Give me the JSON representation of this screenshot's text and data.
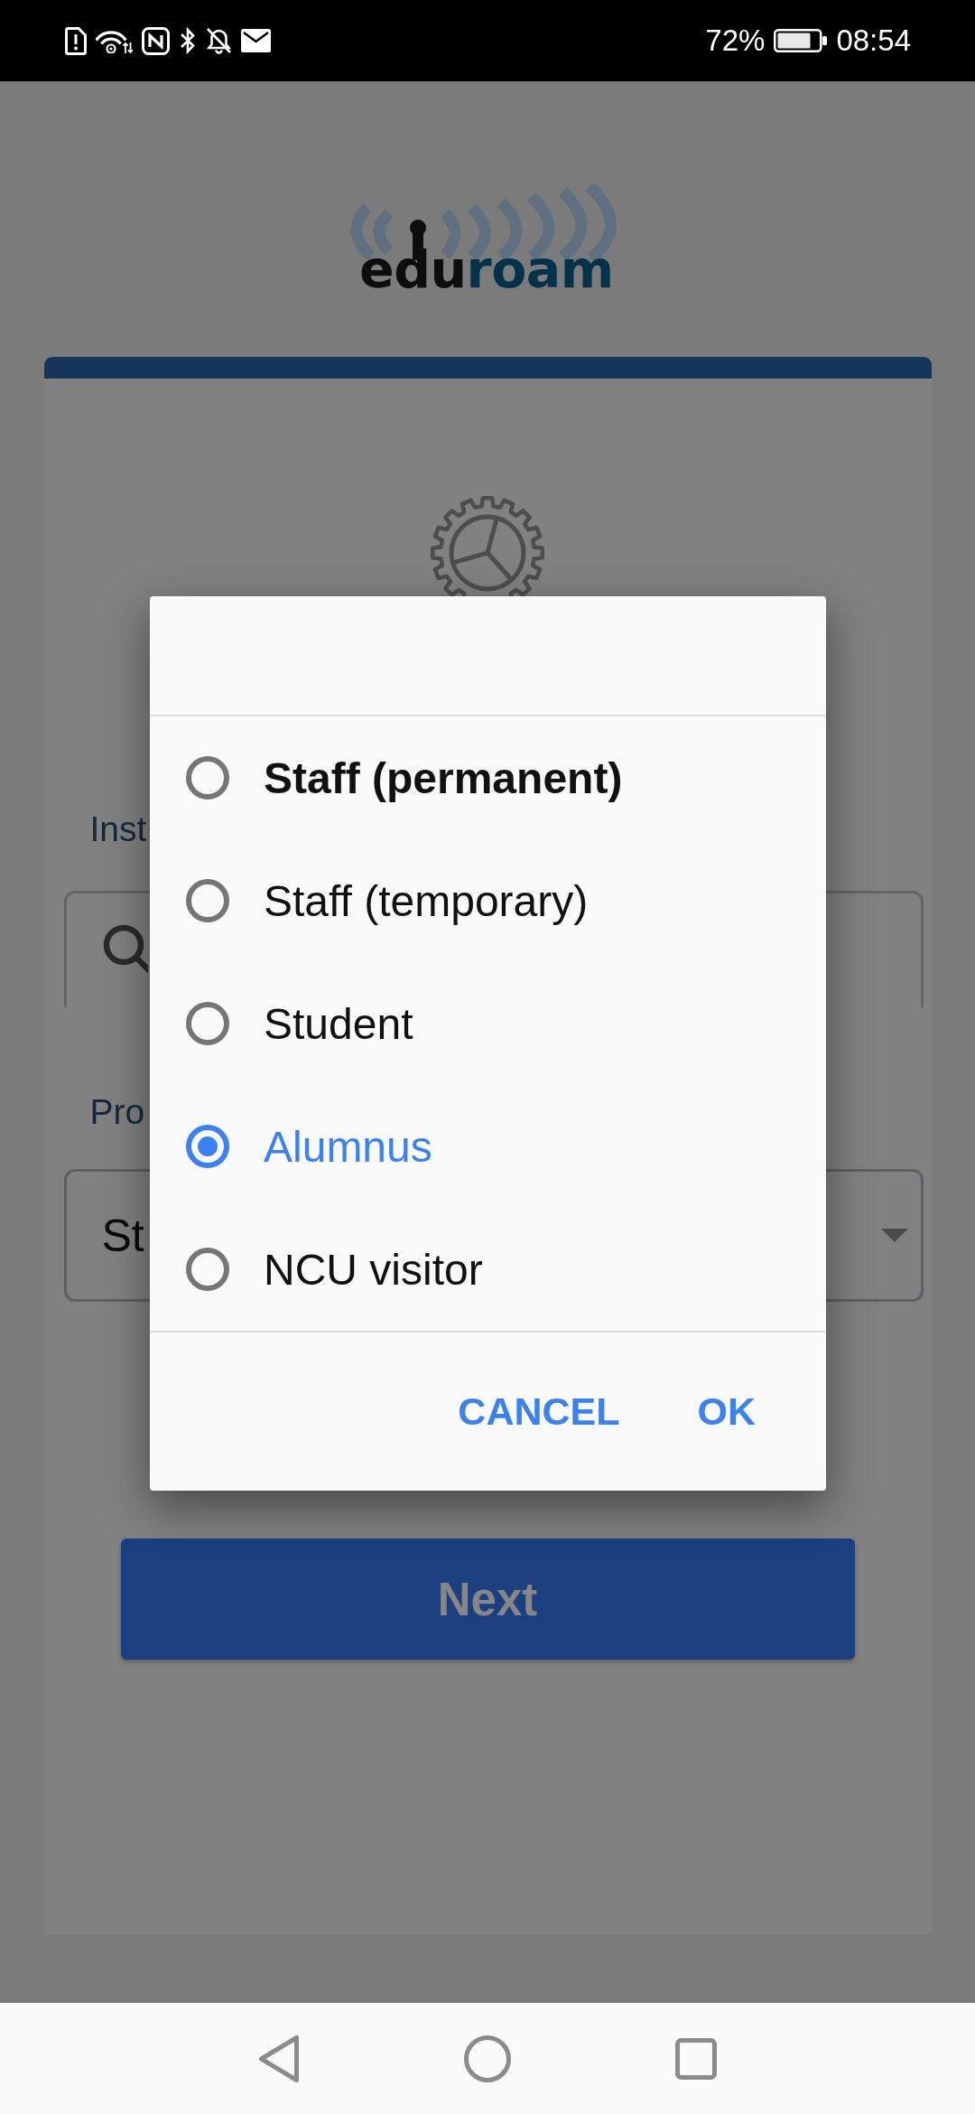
{
  "status_bar": {
    "battery": "72%",
    "time": "08:54"
  },
  "logo": {
    "parts": [
      {
        "text": "edu",
        "color": "#0d0d0d"
      },
      {
        "text": "roam",
        "color": "#00334a"
      }
    ]
  },
  "form": {
    "institution": {
      "label": "Inst"
    },
    "profile": {
      "label": "Pro",
      "value": "St"
    },
    "next_button": "Next"
  },
  "dialog": {
    "options": [
      {
        "label": "Staff (permanent)",
        "emphasized": true,
        "selected": false
      },
      {
        "label": "Staff (temporary)",
        "emphasized": false,
        "selected": false
      },
      {
        "label": "Student",
        "emphasized": false,
        "selected": false
      },
      {
        "label": "Alumnus",
        "emphasized": false,
        "selected": true
      },
      {
        "label": "NCU visitor",
        "emphasized": false,
        "selected": false
      }
    ],
    "buttons": [
      {
        "label": "CANCEL"
      },
      {
        "label": "OK"
      }
    ]
  }
}
